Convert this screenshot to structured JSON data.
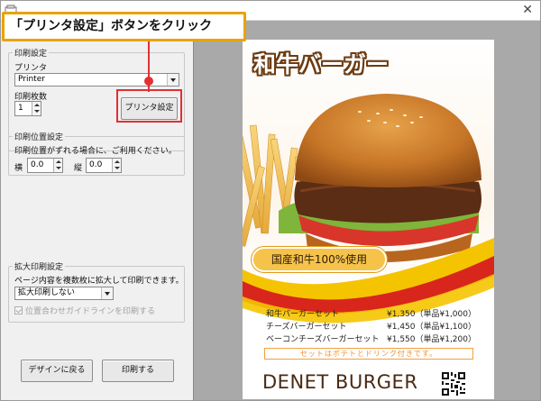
{
  "callout": {
    "text": "「プリンタ設定」ボタンをクリック"
  },
  "print_settings": {
    "group_title": "印刷設定",
    "printer_label": "プリンタ",
    "printer_value": "Printer",
    "copies_label": "印刷枚数",
    "copies_value": "1",
    "printer_settings_button": "プリンタ設定"
  },
  "position_settings": {
    "group_title": "印刷位置設定",
    "description": "印刷位置がずれる場合に、ご利用ください。",
    "horizontal_label": "横",
    "horizontal_value": "0.0",
    "vertical_label": "縦",
    "vertical_value": "0.0"
  },
  "enlarge_settings": {
    "group_title": "拡大印刷設定",
    "description": "ページ内容を複数枚に拡大して印刷できます。",
    "mode_value": "拡大印刷しない",
    "guideline_checkbox": "位置合わせガイドラインを印刷する"
  },
  "buttons": {
    "back_to_design": "デザインに戻る",
    "print": "印刷する"
  },
  "preview": {
    "title": "和牛バーガー",
    "badge": "国産和牛100%使用",
    "menu": [
      {
        "name": "和牛バーガーセット",
        "price": "¥1,350（単品¥1,000）"
      },
      {
        "name": "チーズバーガーセット",
        "price": "¥1,450（単品¥1,100）"
      },
      {
        "name": "ベーコンチーズバーガーセット",
        "price": "¥1,550（単品¥1,200）"
      }
    ],
    "note": "セットはポテトとドリンク付きです。",
    "brand": "DENET BURGER"
  },
  "colors": {
    "callout_border": "#e8a300",
    "highlight": "#e23030",
    "title_stroke": "#6b3b12",
    "badge_fill": "#f6c34a",
    "wave_red": "#d9261c",
    "wave_yellow": "#f5c400",
    "brand_text": "#4a2a12"
  }
}
